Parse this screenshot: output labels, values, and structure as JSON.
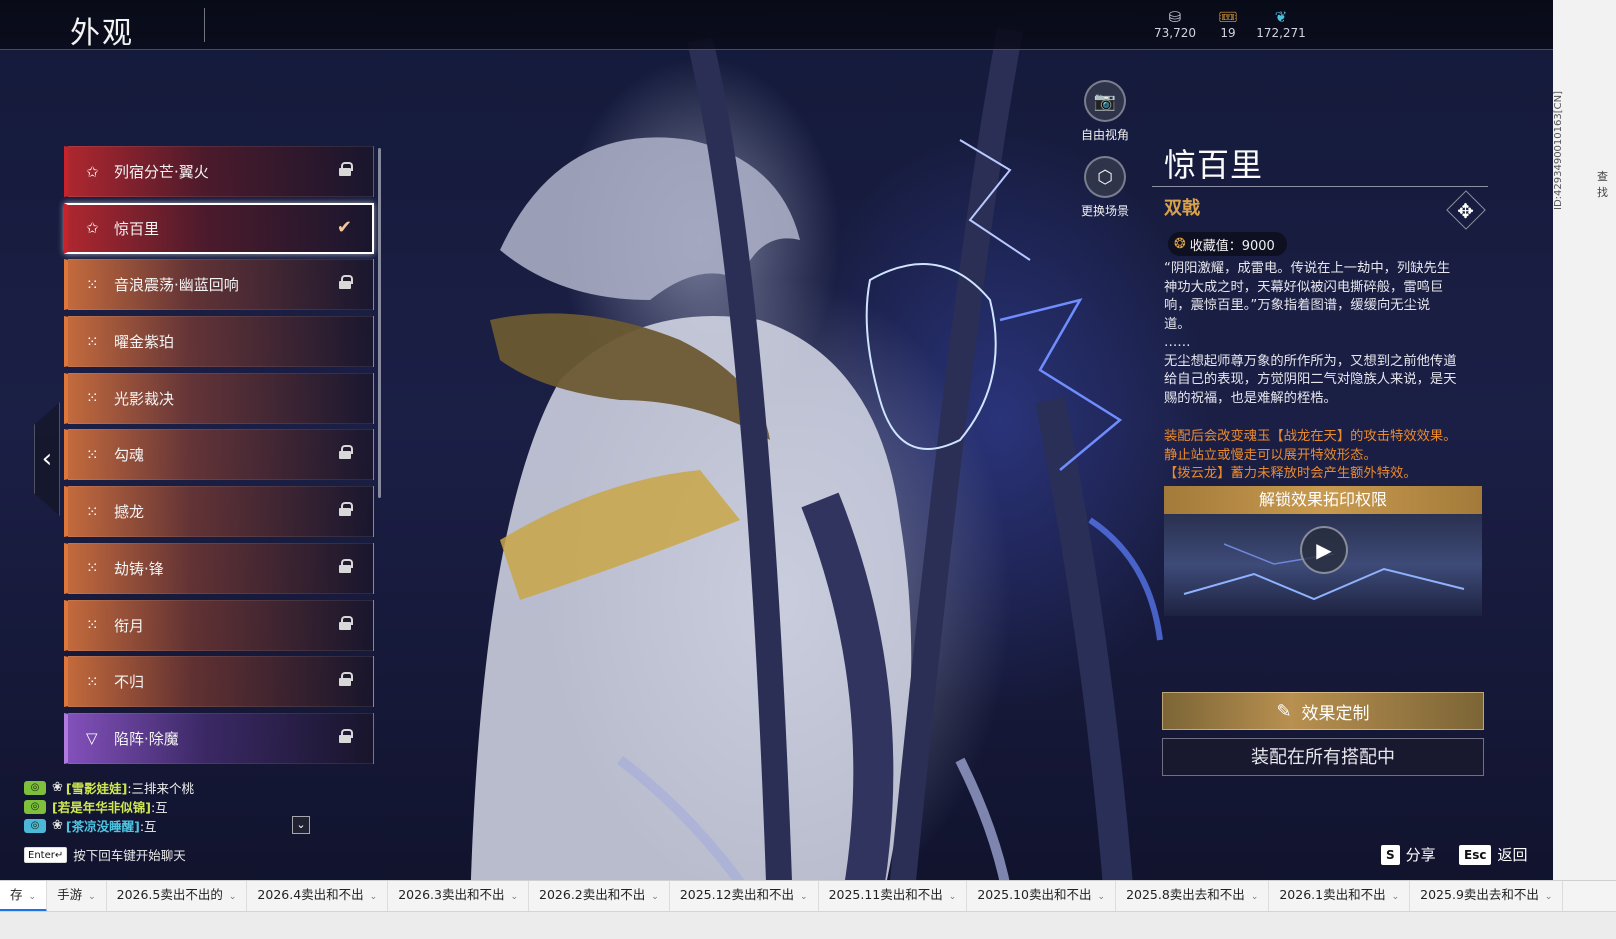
{
  "header": {
    "title": "外观",
    "currencies": [
      {
        "icon": "coin-stack-icon",
        "value": "73,720"
      },
      {
        "icon": "ticket-icon",
        "value": "19"
      },
      {
        "icon": "feather-icon",
        "value": "172,271"
      }
    ]
  },
  "skins": [
    {
      "name": "列宿分芒·翼火",
      "rarity": "red",
      "rarity_glyph": "✩",
      "locked": true,
      "selected": false
    },
    {
      "name": "惊百里",
      "rarity": "red",
      "rarity_glyph": "✩",
      "locked": false,
      "selected": true
    },
    {
      "name": "音浪震荡·幽蓝回响",
      "rarity": "orange",
      "rarity_glyph": "⁙",
      "locked": true,
      "selected": false
    },
    {
      "name": "曜金紫珀",
      "rarity": "orange",
      "rarity_glyph": "⁙",
      "locked": false,
      "selected": false
    },
    {
      "name": "光影裁决",
      "rarity": "orange",
      "rarity_glyph": "⁙",
      "locked": false,
      "selected": false
    },
    {
      "name": "勾魂",
      "rarity": "orange",
      "rarity_glyph": "⁙",
      "locked": true,
      "selected": false
    },
    {
      "name": "撼龙",
      "rarity": "orange",
      "rarity_glyph": "⁙",
      "locked": true,
      "selected": false
    },
    {
      "name": "劫铸·锋",
      "rarity": "orange",
      "rarity_glyph": "⁙",
      "locked": true,
      "selected": false
    },
    {
      "name": "衔月",
      "rarity": "orange",
      "rarity_glyph": "⁙",
      "locked": true,
      "selected": false
    },
    {
      "name": "不归",
      "rarity": "orange",
      "rarity_glyph": "⁙",
      "locked": true,
      "selected": false
    },
    {
      "name": "陷阵·除魔",
      "rarity": "purple",
      "rarity_glyph": "▽",
      "locked": true,
      "selected": false
    }
  ],
  "camera": {
    "free_view": "自由视角",
    "change_scene": "更换场景"
  },
  "detail": {
    "name": "惊百里",
    "type": "双戟",
    "collection": "收藏值：9000",
    "desc_lines": [
      "“阴阳激耀，成雷电。传说在上一劫中，列缺先生",
      "神功大成之时，天幕好似被闪电撕碎般，雷鸣巨",
      "响，震惊百里。”万象指着图谱，缓缓向无尘说",
      "道。",
      "……",
      "无尘想起师尊万象的所作所为，又想到之前他传道",
      "给自己的表现，方觉阴阳二气对隐族人来说，是天",
      "赐的祝福，也是难解的桎梏。"
    ],
    "effect_lines": [
      "装配后会改变魂玉【战龙在天】的攻击特效效果。",
      "静止站立或慢走可以展开特效形态。",
      "【拨云龙】蓄力未释放时会产生额外特效。"
    ],
    "unlock_title": "解锁效果拓印权限",
    "custom_button": "效果定制",
    "equipped_button": "装配在所有搭配中"
  },
  "chat": {
    "lines": [
      {
        "channel": "◎",
        "who": "[雪影娃娃]",
        "msg": ":三排来个桃"
      },
      {
        "channel": "◎",
        "who": "[若是年华非似锦]",
        "msg": ":互"
      },
      {
        "channel": "◎",
        "who": "[茶凉没睡醒]",
        "msg": ":互"
      }
    ],
    "hint_key": "Enter↵",
    "hint": "按下回车键开始聊天"
  },
  "bottom": {
    "share_key": "S",
    "share": "分享",
    "back_key": "Esc",
    "back": "返回"
  },
  "side": {
    "vertical_id": "ID:4293490010163[CN]",
    "fragment": "查找"
  },
  "sheet_tabs": [
    "存",
    "手游",
    "2026.5卖出不出的",
    "2026.4卖出和不出",
    "2026.3卖出和不出",
    "2026.2卖出和不出",
    "2025.12卖出和不出",
    "2025.11卖出和不出",
    "2025.10卖出和不出",
    "2025.8卖出去和不出",
    "2026.1卖出和不出",
    "2025.9卖出去和不出"
  ],
  "colors": {
    "accent_gold": "#d9a24a",
    "effect_orange": "#e98a2e",
    "rarity_red": "#c8222a",
    "rarity_orange": "#e0773a",
    "rarity_purple": "#b17adf"
  }
}
